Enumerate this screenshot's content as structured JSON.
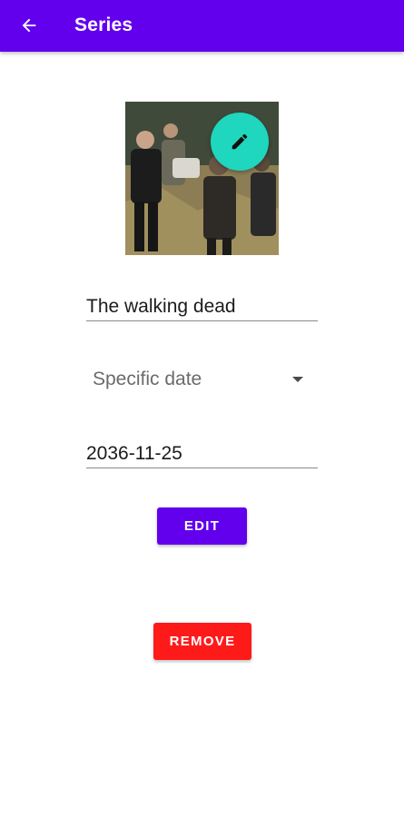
{
  "appbar": {
    "title": "Series",
    "back_icon": "arrow-left-icon"
  },
  "poster": {
    "alt": "Series poster",
    "edit_icon": "pencil-icon"
  },
  "form": {
    "title_value": "The walking dead",
    "date_type_selected": "Specific date",
    "date_value": "2036-11-25"
  },
  "actions": {
    "edit_label": "EDIT",
    "remove_label": "REMOVE"
  },
  "colors": {
    "primary": "#6200EE",
    "fab": "#1FD6BE",
    "danger": "#FF1A1A"
  }
}
